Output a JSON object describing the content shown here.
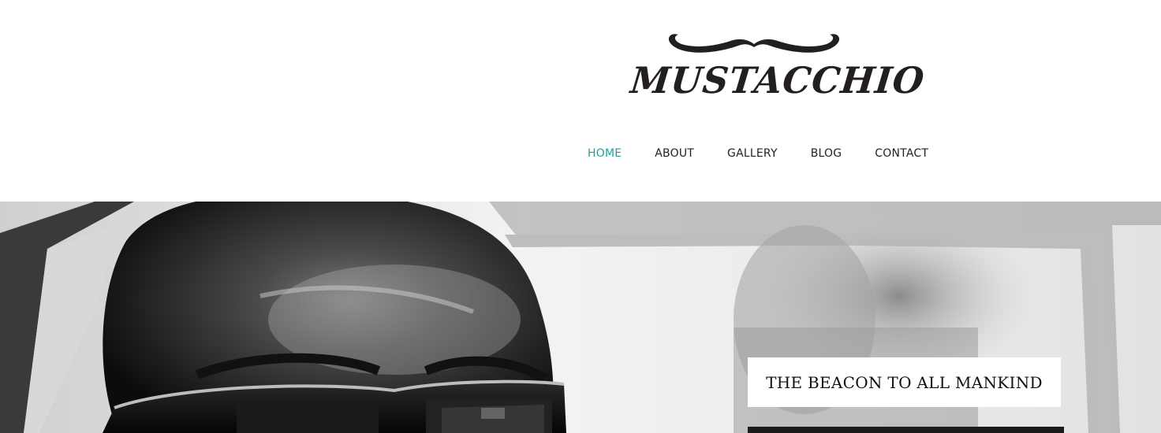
{
  "brand": {
    "name": "MUSTACCHIO",
    "logo_icon": "mustache-icon"
  },
  "nav": {
    "items": [
      {
        "label": "HOME",
        "active": true
      },
      {
        "label": "ABOUT",
        "active": false
      },
      {
        "label": "GALLERY",
        "active": false
      },
      {
        "label": "BLOG",
        "active": false
      },
      {
        "label": "CONTACT",
        "active": false
      }
    ]
  },
  "hero": {
    "tagline": "THE BEACON TO ALL MANKIND"
  },
  "colors": {
    "accent": "#1aa39c",
    "text": "#222222",
    "logo": "#231f20"
  }
}
